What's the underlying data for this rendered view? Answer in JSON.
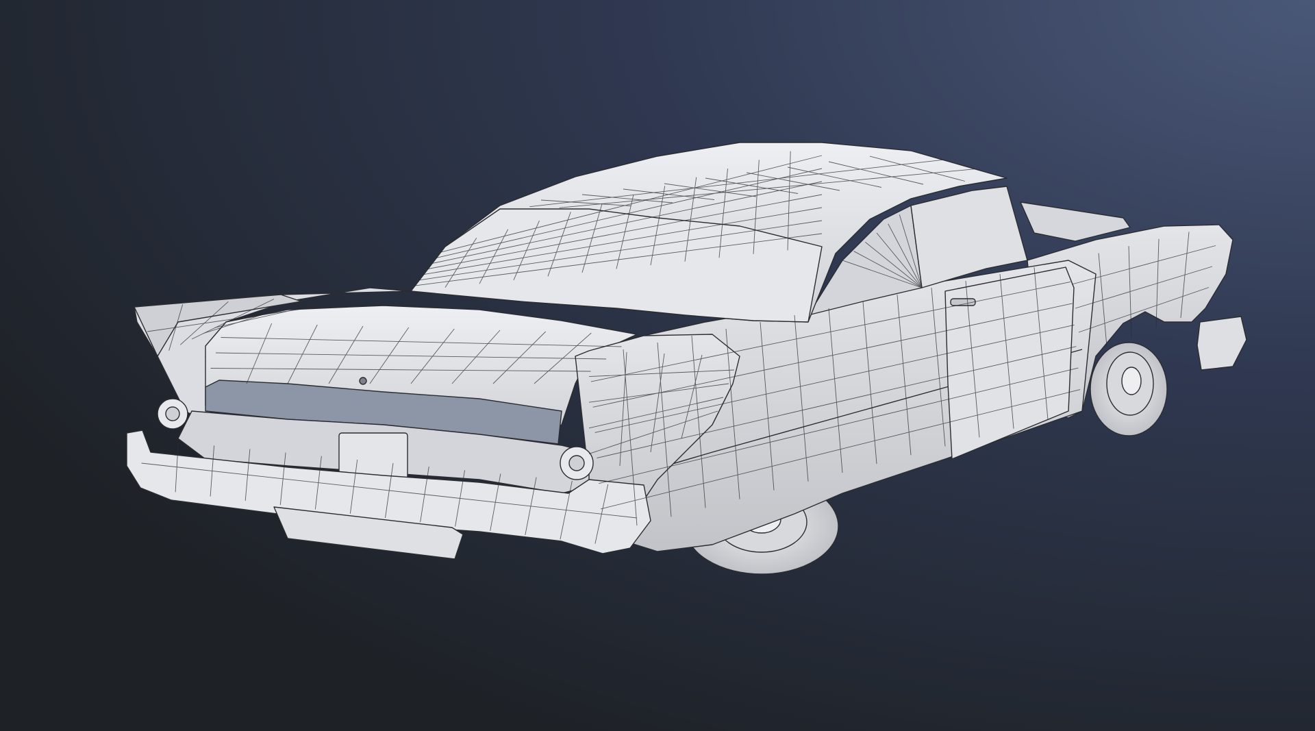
{
  "scene": {
    "subject": "car-wireframe-model",
    "colors": {
      "background_left": "#1f2328",
      "background_right": "#3d4a68",
      "body_fill": "#e3e3e7",
      "body_shadow": "#b9bac0",
      "panel_shadow": "#9fa2aa",
      "wire": "#2a2c31",
      "tire_fill": "#d6d7db"
    },
    "icons": [
      "trunk-keyhole-icon",
      "door-handle-icon"
    ]
  }
}
